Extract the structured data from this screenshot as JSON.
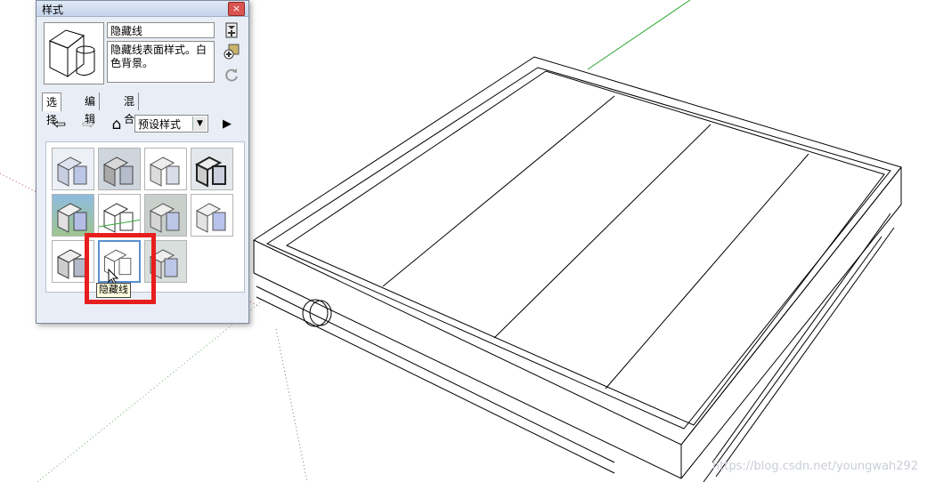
{
  "panel": {
    "title": "样式",
    "close_glyph": "×",
    "style_name": "隐藏线",
    "style_description": "隐藏线表面样式。白色背景。",
    "tabs": [
      {
        "label": "选择"
      },
      {
        "label": "编辑"
      },
      {
        "label": "混合"
      }
    ],
    "collection_value": "预设样式",
    "select_arrow_glyph": "▼",
    "nav": {
      "back_glyph": "⇦",
      "forward_glyph": "⇨",
      "home_glyph": "⌂",
      "details_glyph": "▶"
    },
    "icons": [
      "add-style-icon",
      "create-style-icon",
      "update-style-icon",
      "back-arrow-icon",
      "forward-arrow-icon",
      "home-icon",
      "details-icon"
    ],
    "tooltip": "隐藏线"
  },
  "watermark": "https://blog.csdn.net/youngwah292",
  "colors": {
    "selection_highlight": "#e81e1e",
    "panel_bg": "#e9eef6",
    "axis_green": "#2aa52a"
  }
}
